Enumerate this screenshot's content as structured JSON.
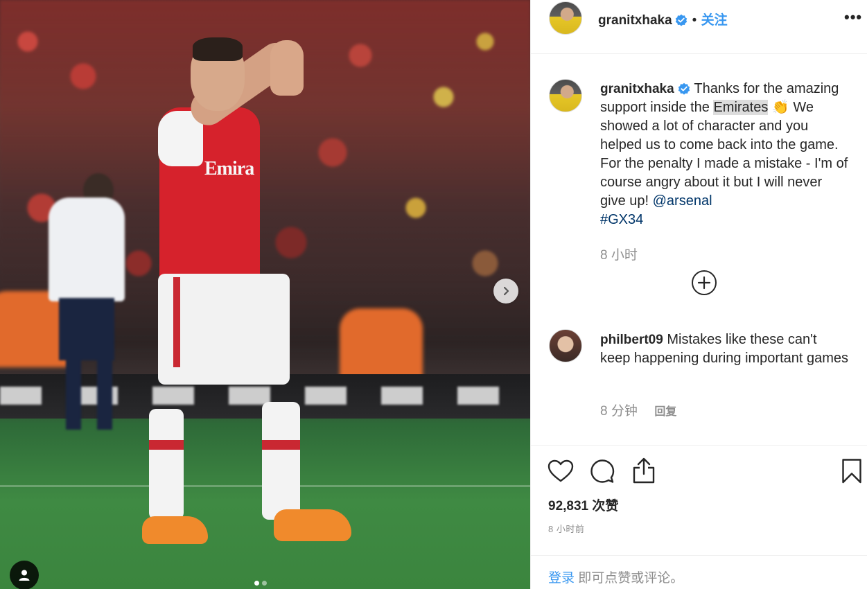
{
  "post": {
    "username": "granitxhaka",
    "follow_label": "关注",
    "more_label": "•••"
  },
  "caption": {
    "username": "granitxhaka",
    "text_1": "Thanks for the amazing support inside the ",
    "highlight": "Emirates",
    "emoji": "👏",
    "text_2": " We showed a lot of character and you helped us to come back into the game. For the penalty I made a mistake - I'm of course angry about it but I will never give up! ",
    "mention": "@arsenal",
    "hashtag": "#GX34",
    "time": "8 小时"
  },
  "comment": {
    "username": "philbert09",
    "text": "Mistakes like these can't keep happening during important games",
    "time": "8 分钟",
    "reply_label": "回复"
  },
  "stats": {
    "likes": "92,831 次赞",
    "post_time": "8 小时前"
  },
  "login": {
    "link": "登录",
    "text": "即可点赞或评论。"
  },
  "photo": {
    "shirt_text": "Emira",
    "carousel_total": 2,
    "carousel_active": 1
  },
  "icons": {
    "like": "heart-icon",
    "comment": "comment-bubble-icon",
    "share": "share-icon",
    "save": "bookmark-icon",
    "verified": "verified-badge-icon",
    "next": "chevron-right-icon",
    "tag": "user-tag-icon",
    "load_more": "plus-circle-icon"
  },
  "colors": {
    "accent": "#3897f0",
    "link": "#003569",
    "muted": "#8e8e8e",
    "text": "#262626"
  }
}
